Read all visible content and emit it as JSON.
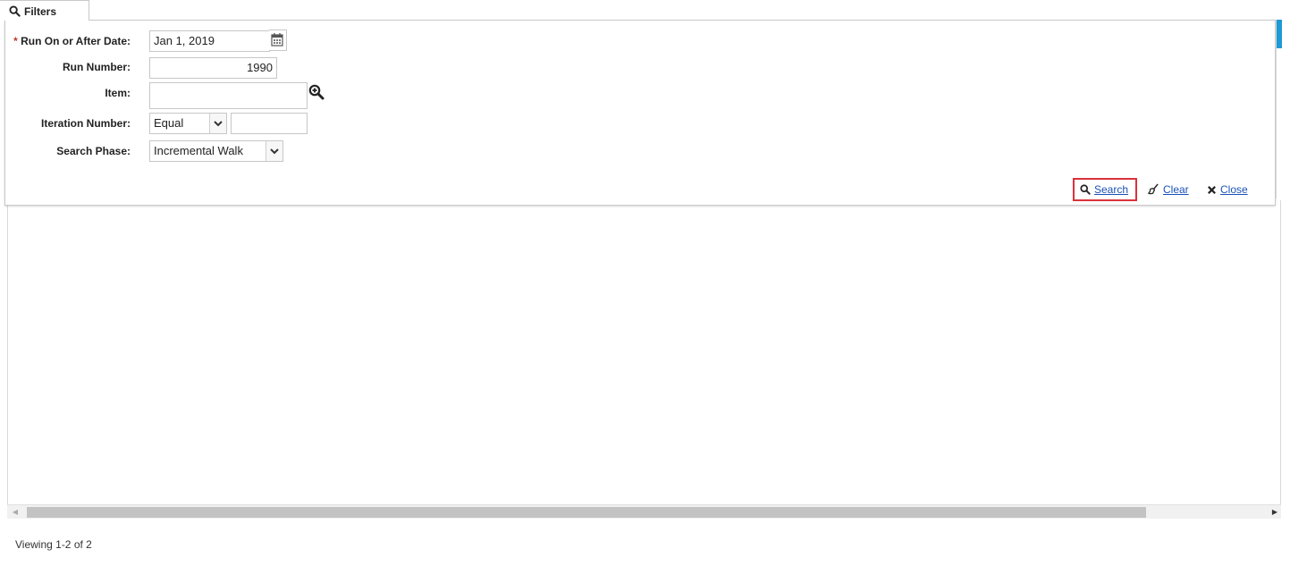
{
  "filters_tab": {
    "label": "Filters",
    "icon": "search-icon"
  },
  "fields": {
    "run_on_or_after": {
      "required_mark": "*",
      "label": "Run On or After Date:",
      "value": "Jan 1, 2019"
    },
    "run_number": {
      "label": "Run Number:",
      "value": "1990"
    },
    "item": {
      "label": "Item:",
      "value": ""
    },
    "iteration_number": {
      "label": "Iteration Number:",
      "operator": "Equal",
      "value": ""
    },
    "search_phase": {
      "label": "Search Phase:",
      "value": "Incremental Walk"
    }
  },
  "actions": {
    "search": "Search",
    "clear": "Clear",
    "close": "Close"
  },
  "status": {
    "viewing": "Viewing 1-2 of 2"
  },
  "colors": {
    "link": "#1a52b8",
    "highlight": "#d9323b",
    "accent": "#1e9ad6"
  }
}
